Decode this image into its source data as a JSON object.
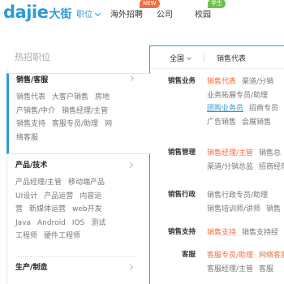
{
  "logo": {
    "text_en": "dajie",
    "text_cn": "大街"
  },
  "nav": {
    "job": "职位",
    "overseas": "海外招聘",
    "overseas_badge": "NEW",
    "company": "公司",
    "campus": "校园",
    "campus_badge": "学生"
  },
  "hot_title": "热招职位",
  "categories": [
    {
      "title": "销售/客服",
      "items": [
        "销售代表",
        "大客户销售",
        "房地",
        "产销售/中介",
        "销售经理/主管",
        "销售支持",
        "客服专员/助理",
        "网",
        "络客服"
      ]
    },
    {
      "title": "产品/技术",
      "items": [
        "产品经理/主管",
        "移动端产品",
        "UI设计",
        "产品运营",
        "内容运",
        "营",
        "新媒体运营",
        "web开发",
        "Java",
        "Android",
        "IOS",
        "测试",
        "工程师",
        "硬件工程师"
      ]
    },
    {
      "title": "生产/制造",
      "items": []
    }
  ],
  "breadcrumb": {
    "city": "全国",
    "position": "销售代表"
  },
  "groups": [
    {
      "label": "销售业务",
      "items": [
        {
          "text": "销售代表",
          "style": "hl"
        },
        {
          "text": "渠道/分销",
          "style": ""
        },
        {
          "text": "业务拓展专员/助理",
          "style": ""
        },
        {
          "text": "团购业务员",
          "style": "blue"
        },
        {
          "text": "招商专员",
          "style": ""
        },
        {
          "text": "广告销售",
          "style": ""
        },
        {
          "text": "会展销售",
          "style": ""
        }
      ]
    },
    {
      "label": "销售管理",
      "items": [
        {
          "text": "销售经理/主管",
          "style": "hl"
        },
        {
          "text": "销售总",
          "style": ""
        },
        {
          "text": "渠道/分销总监",
          "style": ""
        },
        {
          "text": "招商经理",
          "style": ""
        }
      ]
    },
    {
      "label": "销售行政",
      "items": [
        {
          "text": "销售行政专员/助理",
          "style": ""
        },
        {
          "text": "销售培训师/讲师",
          "style": ""
        },
        {
          "text": "销售",
          "style": ""
        }
      ]
    },
    {
      "label": "销售支持",
      "items": [
        {
          "text": "销售支持",
          "style": "hl"
        },
        {
          "text": "销售支持经",
          "style": ""
        }
      ]
    },
    {
      "label": "客服",
      "items": [
        {
          "text": "客服专员/助理",
          "style": "hl"
        },
        {
          "text": "网络客服",
          "style": "hl"
        },
        {
          "text": "客服经理/主管",
          "style": ""
        },
        {
          "text": "客服",
          "style": ""
        }
      ]
    }
  ],
  "colors": {
    "brand": "#2e9ad7",
    "accent": "#f26d40",
    "student_badge": "#6cc04a"
  }
}
